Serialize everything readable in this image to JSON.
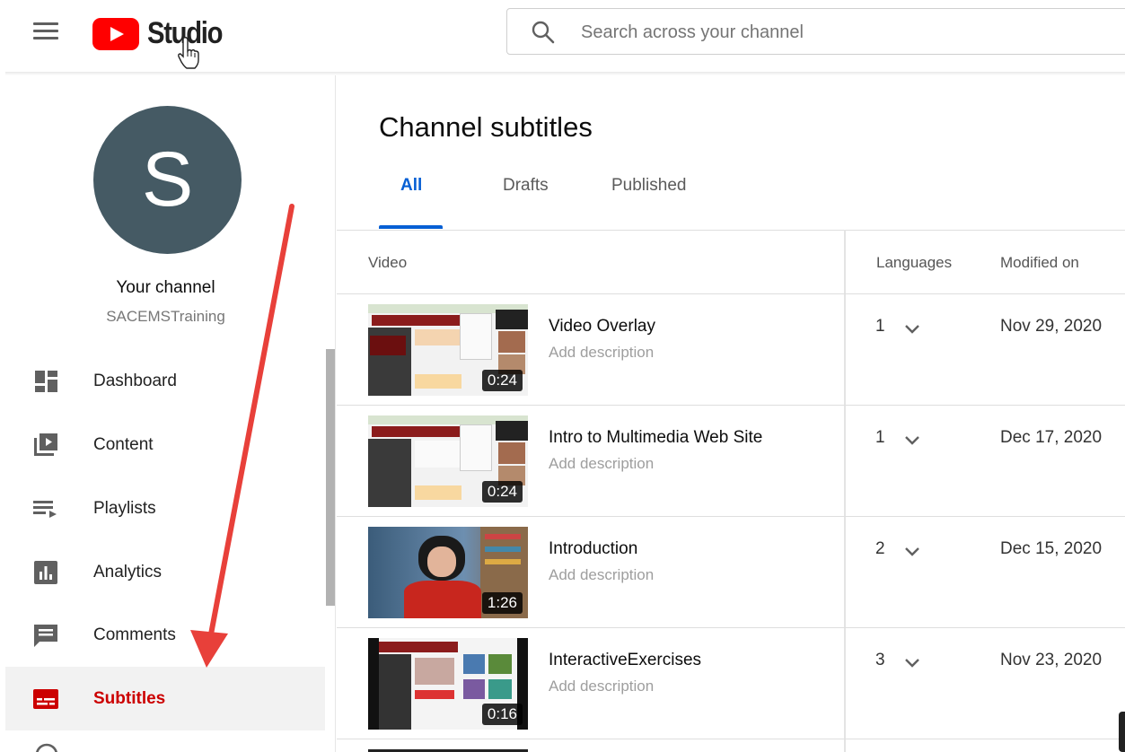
{
  "header": {
    "logo_text": "Studio",
    "search_placeholder": "Search across your channel"
  },
  "sidebar": {
    "avatar_letter": "S",
    "your_channel_label": "Your channel",
    "channel_name": "SACEMSTraining",
    "items": [
      {
        "label": "Dashboard",
        "icon": "dashboard-icon"
      },
      {
        "label": "Content",
        "icon": "content-icon"
      },
      {
        "label": "Playlists",
        "icon": "playlists-icon"
      },
      {
        "label": "Analytics",
        "icon": "analytics-icon"
      },
      {
        "label": "Comments",
        "icon": "comments-icon"
      },
      {
        "label": "Subtitles",
        "icon": "subtitles-icon",
        "active": true
      }
    ]
  },
  "main": {
    "title": "Channel subtitles",
    "tabs": [
      {
        "label": "All",
        "active": true
      },
      {
        "label": "Drafts"
      },
      {
        "label": "Published"
      }
    ],
    "columns": {
      "video": "Video",
      "languages": "Languages",
      "modified": "Modified on"
    },
    "rows": [
      {
        "title": "Video Overlay",
        "description": "Add description",
        "duration": "0:24",
        "languages": "1",
        "modified": "Nov 29, 2020"
      },
      {
        "title": "Intro to Multimedia Web Site",
        "description": "Add description",
        "duration": "0:24",
        "languages": "1",
        "modified": "Dec 17, 2020"
      },
      {
        "title": "Introduction",
        "description": "Add description",
        "duration": "1:26",
        "languages": "2",
        "modified": "Dec 15, 2020"
      },
      {
        "title": "InteractiveExercises",
        "description": "Add description",
        "duration": "0:16",
        "languages": "3",
        "modified": "Nov 23, 2020"
      }
    ]
  },
  "colors": {
    "accent_blue": "#065fd4",
    "brand_red": "#ff0000",
    "active_red": "#cc0000",
    "avatar_bg": "#455a64"
  }
}
